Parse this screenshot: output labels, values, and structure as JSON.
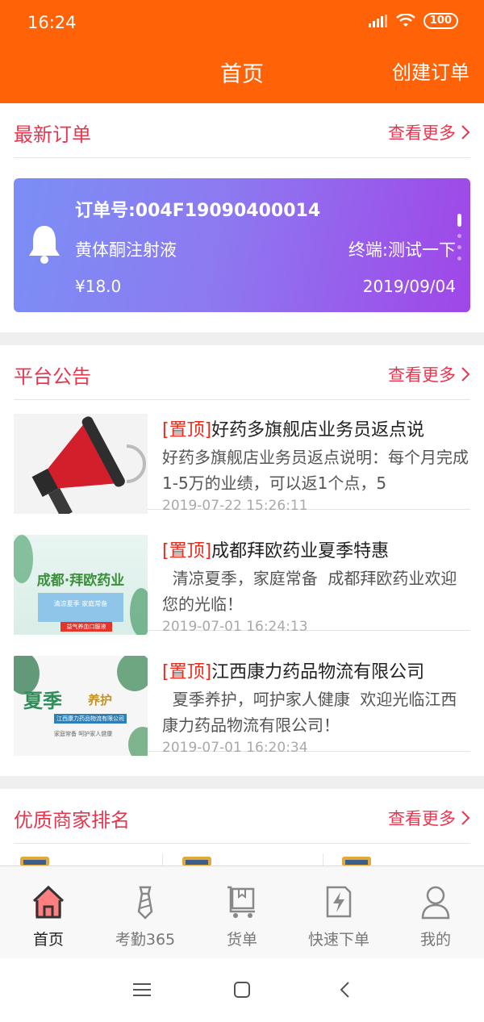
{
  "status_bar": {
    "time": "16:24",
    "battery": "100"
  },
  "nav": {
    "title": "首页",
    "action": "创建订单"
  },
  "latest_orders": {
    "title": "最新订单",
    "more": "查看更多",
    "order": {
      "number": "订单号:004F19090400014",
      "product": "黄体酮注射液",
      "terminal": "终端:测试一下",
      "price": "¥18.0",
      "date": "2019/09/04"
    }
  },
  "announcements": {
    "title": "平台公告",
    "more": "查看更多",
    "items": [
      {
        "tag": "[置顶]",
        "title": "好药多旗舰店业务员返点说",
        "body": "好药多旗舰店业务员返点说明：每个月完成1-5万的业绩，可以返1个点，5",
        "time": "2019-07-22 15:26:11",
        "icon": "megaphone-icon"
      },
      {
        "tag": "[置顶]",
        "title": "成都拜欧药业夏季特惠",
        "body": "  清凉夏季，家庭常备  成都拜欧药业欢迎您的光临！",
        "time": "2019-07-01 16:24:13",
        "thumb_text": "成都·拜欧药业",
        "thumb_small": [
          "清凉夏季 家庭常备",
          "益气养血口服液"
        ]
      },
      {
        "tag": "[置顶]",
        "title": "江西康力药品物流有限公司",
        "body": "  夏季养护，呵护家人健康  欢迎光临江西康力药品物流有限公司！",
        "time": "2019-07-01 16:20:34",
        "thumb_text": "夏季",
        "thumb_text2": "养护",
        "thumb_small": [
          "江西康力药品物流有限公司",
          "家庭常备  呵护家人健康"
        ]
      }
    ]
  },
  "merchants": {
    "title": "优质商家排名",
    "more": "查看更多"
  },
  "tabbar": {
    "items": [
      {
        "label": "首页",
        "icon": "home-icon",
        "active": true
      },
      {
        "label": "考勤365",
        "icon": "tie-icon"
      },
      {
        "label": "货单",
        "icon": "cart-icon"
      },
      {
        "label": "快速下单",
        "icon": "lightning-icon"
      },
      {
        "label": "我的",
        "icon": "user-icon"
      }
    ]
  },
  "colors": {
    "brand_orange": "#ff6207",
    "accent_red": "#e8364e",
    "tag_red": "#e8291b"
  }
}
